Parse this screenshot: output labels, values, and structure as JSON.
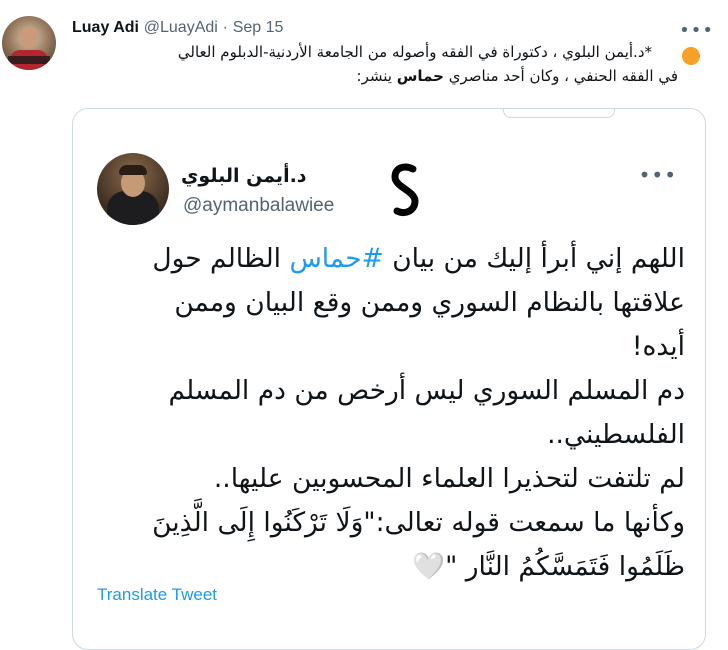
{
  "outer_tweet": {
    "author_name": "Luay Adi",
    "handle": "@LuayAdi",
    "separator": "·",
    "date": "Sep 15",
    "more_label": "•••",
    "text_line1": "*د.أيمن البلوي ، دكتوراة في الفقه وأصوله من الجامعة الأردنية-الدبلوم العالي",
    "text_line2_before": "في الفقه الحنفي ، وكان أحد مناصري ",
    "text_line2_bold": "حماس",
    "text_line2_after": " ينشر:"
  },
  "quoted_tweet": {
    "author_name": "د.أيمن البلوي",
    "handle": "@aymanbalawiee",
    "more_label": "•••",
    "line1_before": "اللهم إني أبرأ إليك من بيان ",
    "line1_hashtag": "#حماس",
    "line1_after": " الظالم حول",
    "line2": "علاقتها بالنظام السوري وممن وقع البيان وممن",
    "line3": "أيده!",
    "line4": "دم المسلم السوري ليس أرخص من دم المسلم",
    "line5": "الفلسطيني..",
    "line6": "لم تلتفت لتحذيرا العلماء المحسوبين عليها..",
    "line7": "وكأنها ما سمعت قوله تعالى:\"وَلَا تَرْكَنُوا إِلَى الَّذِينَ",
    "line8": "ظَلَمُوا فَتَمَسَّكُمُ النَّار \"🤍"
  },
  "translate_label": "Translate Tweet",
  "colors": {
    "link": "#1d9bf0",
    "muted": "#536471",
    "dot": "#f7a128"
  }
}
